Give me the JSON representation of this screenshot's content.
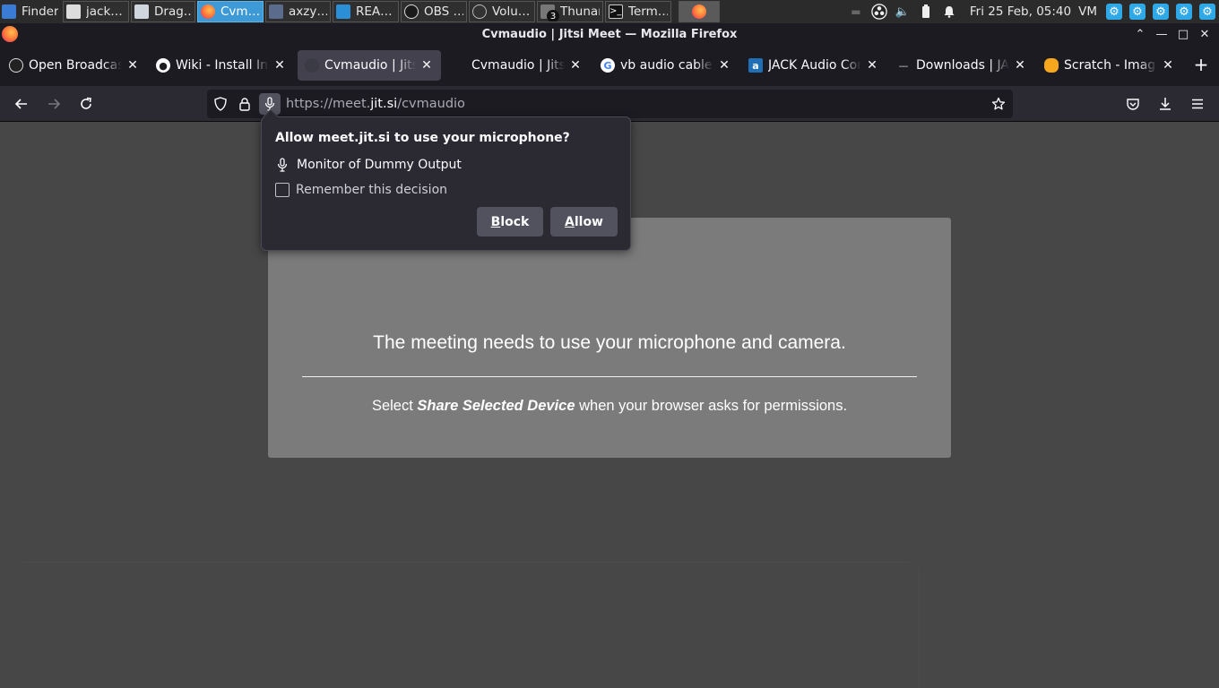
{
  "taskbar": {
    "items": [
      {
        "label": "Finder",
        "icon": "finder-icon"
      },
      {
        "label": "jack…",
        "icon": "document-icon"
      },
      {
        "label": "Drag…",
        "icon": "window-icon"
      },
      {
        "label": "Cvm…",
        "icon": "firefox-icon"
      },
      {
        "label": "axzy…",
        "icon": "app-icon"
      },
      {
        "label": "REA…",
        "icon": "reaper-icon"
      },
      {
        "label": "OBS …",
        "icon": "obs-icon"
      },
      {
        "label": "Volu…",
        "icon": "volume-app-icon"
      },
      {
        "label": "Thunar",
        "icon": "folder-icon",
        "badge": "3"
      },
      {
        "label": "Term…",
        "icon": "terminal-icon"
      },
      {
        "label": "",
        "icon": "firefox-icon"
      }
    ],
    "clock": "Fri 25 Feb, 05:40",
    "workspace": "VM"
  },
  "window": {
    "title": "Cvmaudio | Jitsi Meet — Mozilla Firefox"
  },
  "tabs": [
    {
      "label": "Open Broadcaster",
      "icon": "obs-icon"
    },
    {
      "label": "Wiki - Install Instr",
      "icon": "github-icon"
    },
    {
      "label": "Cvmaudio | Jitsi Me",
      "icon": "jitsi-icon",
      "selected": true
    },
    {
      "label": "Cvmaudio | Jitsi M",
      "icon": "blank-icon"
    },
    {
      "label": "vb audio cable linu",
      "icon": "google-icon"
    },
    {
      "label": "JACK Audio Connec",
      "icon": "jack-icon"
    },
    {
      "label": "Downloads | JACK A",
      "icon": "jack-dash-icon"
    },
    {
      "label": "Scratch - Imagine,",
      "icon": "scratch-icon"
    }
  ],
  "nav": {
    "url_prefix": "https://meet.",
    "url_host": "jit.si",
    "url_path": "/cvmaudio"
  },
  "popup": {
    "question": "Allow meet.jit.si to use your microphone?",
    "device": "Monitor of Dummy Output",
    "remember_label": "Remember this decision",
    "remember_checked": false,
    "block_accel": "B",
    "block_rest": "lock",
    "allow_accel": "A",
    "allow_rest": "llow"
  },
  "page": {
    "title": "The meeting needs to use your microphone and camera.",
    "sub_before": "Select ",
    "sub_bold": "Share Selected Device",
    "sub_after": " when your browser asks for permissions."
  },
  "colors": {
    "taskbar_active": "#3d9ad6",
    "browser_chrome": "#1c1b22",
    "toolbar": "#2b2a33",
    "page_bg": "#474747",
    "card_bg": "#7b7b7b"
  }
}
